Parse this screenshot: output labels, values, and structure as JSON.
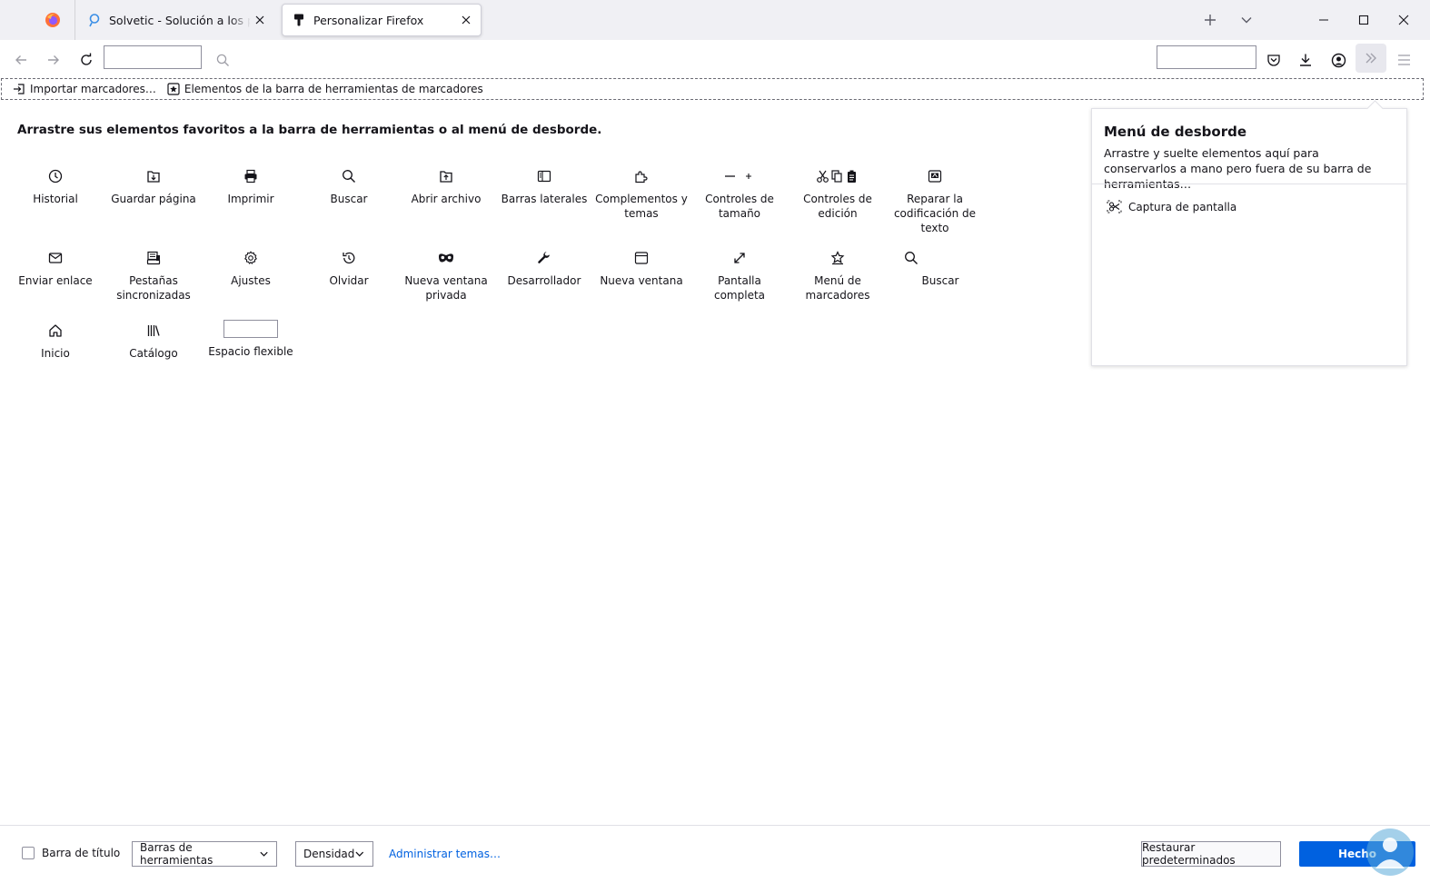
{
  "tabs": [
    {
      "title": "Solvetic - Solución a los problemas informáticos"
    },
    {
      "title": "Personalizar Firefox"
    }
  ],
  "bookmarks_toolbar": {
    "import_label": "Importar marcadores…",
    "elements_label": "Elementos de la barra de herramientas de marcadores"
  },
  "customize": {
    "instructions": "Arrastre sus elementos favoritos a la barra de herramientas o al menú de desborde.",
    "palette": [
      {
        "label": "Historial",
        "icon": "clock-icon"
      },
      {
        "label": "Guardar página",
        "icon": "save-page-icon"
      },
      {
        "label": "Imprimir",
        "icon": "print-icon"
      },
      {
        "label": "Buscar",
        "icon": "search-icon"
      },
      {
        "label": "Abrir archivo",
        "icon": "open-file-icon"
      },
      {
        "label": "Barras laterales",
        "icon": "sidebar-icon"
      },
      {
        "label": "Complementos y temas",
        "icon": "puzzle-icon"
      },
      {
        "label": "Controles de tamaño",
        "icon": "zoom-controls-icon"
      },
      {
        "label": "Controles de edición",
        "icon": "edit-controls-icon"
      },
      {
        "label": "Reparar la codificación de texto",
        "icon": "text-encoding-icon"
      },
      {
        "label": "Enviar enlace",
        "icon": "mail-icon"
      },
      {
        "label": "Pestañas sincronizadas",
        "icon": "synced-tabs-icon"
      },
      {
        "label": "Ajustes",
        "icon": "gear-icon"
      },
      {
        "label": "Olvidar",
        "icon": "forget-icon"
      },
      {
        "label": "Nueva ventana privada",
        "icon": "private-mask-icon"
      },
      {
        "label": "Desarrollador",
        "icon": "wrench-icon"
      },
      {
        "label": "Nueva ventana",
        "icon": "new-window-icon"
      },
      {
        "label": "Pantalla completa",
        "icon": "fullscreen-icon"
      },
      {
        "label": "Menú de marcadores",
        "icon": "bookmark-star-icon"
      },
      {
        "label": "Buscar",
        "icon": "search-icon"
      },
      {
        "label": "Inicio",
        "icon": "home-icon"
      },
      {
        "label": "Catálogo",
        "icon": "library-icon"
      },
      {
        "label": "Espacio flexible",
        "icon": "flexible-space-box"
      }
    ]
  },
  "overflow_panel": {
    "title": "Menú de desborde",
    "description": "Arrastre y suelte elementos aquí para conservarlos a mano pero fuera de su barra de herramientas…",
    "items": [
      {
        "label": "Captura de pantalla",
        "icon": "screenshot-icon"
      }
    ]
  },
  "footer": {
    "title_bar_label": "Barra de título",
    "toolbars_label": "Barras de herramientas",
    "density_label": "Densidad",
    "manage_themes_label": "Administrar temas…",
    "restore_label": "Restaurar predeterminados",
    "done_label": "Hecho"
  },
  "colors": {
    "accent": "#0061e0",
    "tabstrip": "#f0f0f4"
  }
}
